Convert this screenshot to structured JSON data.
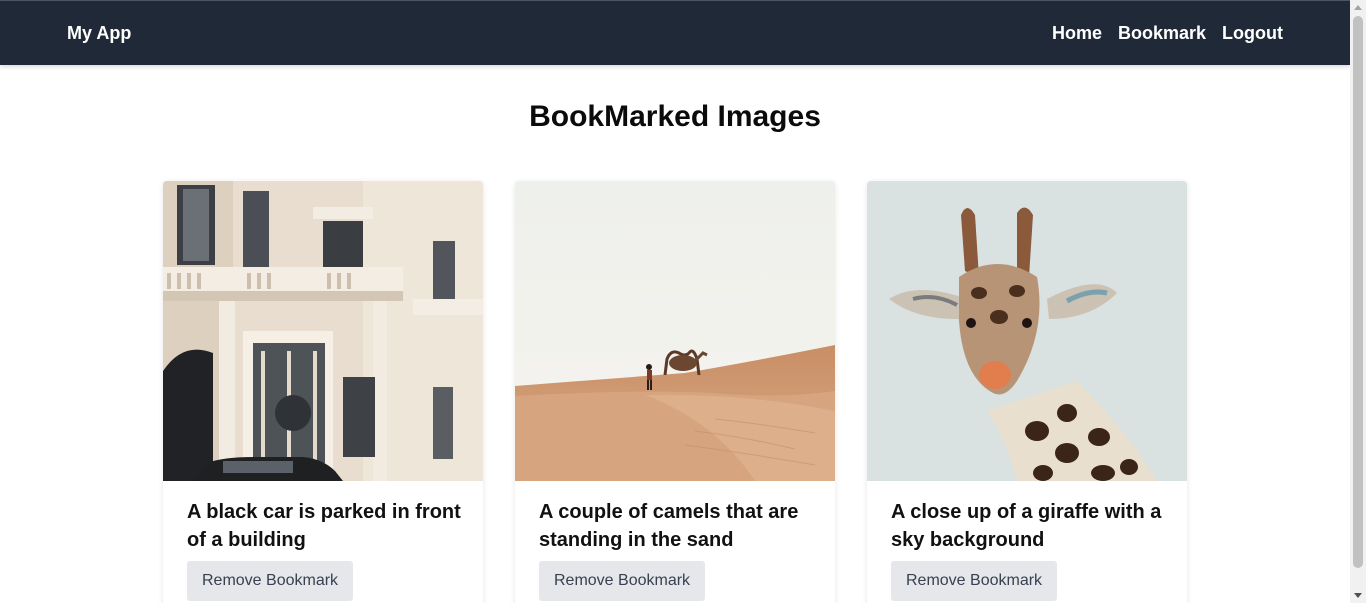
{
  "navbar": {
    "brand": "My App",
    "links": [
      "Home",
      "Bookmark",
      "Logout"
    ]
  },
  "page": {
    "title": "BookMarked Images"
  },
  "cards": [
    {
      "title": "A black car is parked in front of a building",
      "button": "Remove Bookmark",
      "image_icon": "building-photo"
    },
    {
      "title": "A couple of camels that are standing in the sand",
      "button": "Remove Bookmark",
      "image_icon": "desert-camel-photo"
    },
    {
      "title": "A close up of a giraffe with a sky background",
      "button": "Remove Bookmark",
      "image_icon": "giraffe-photo"
    }
  ],
  "colors": {
    "navbar_bg": "#1f2937",
    "button_bg": "#e5e7eb"
  }
}
